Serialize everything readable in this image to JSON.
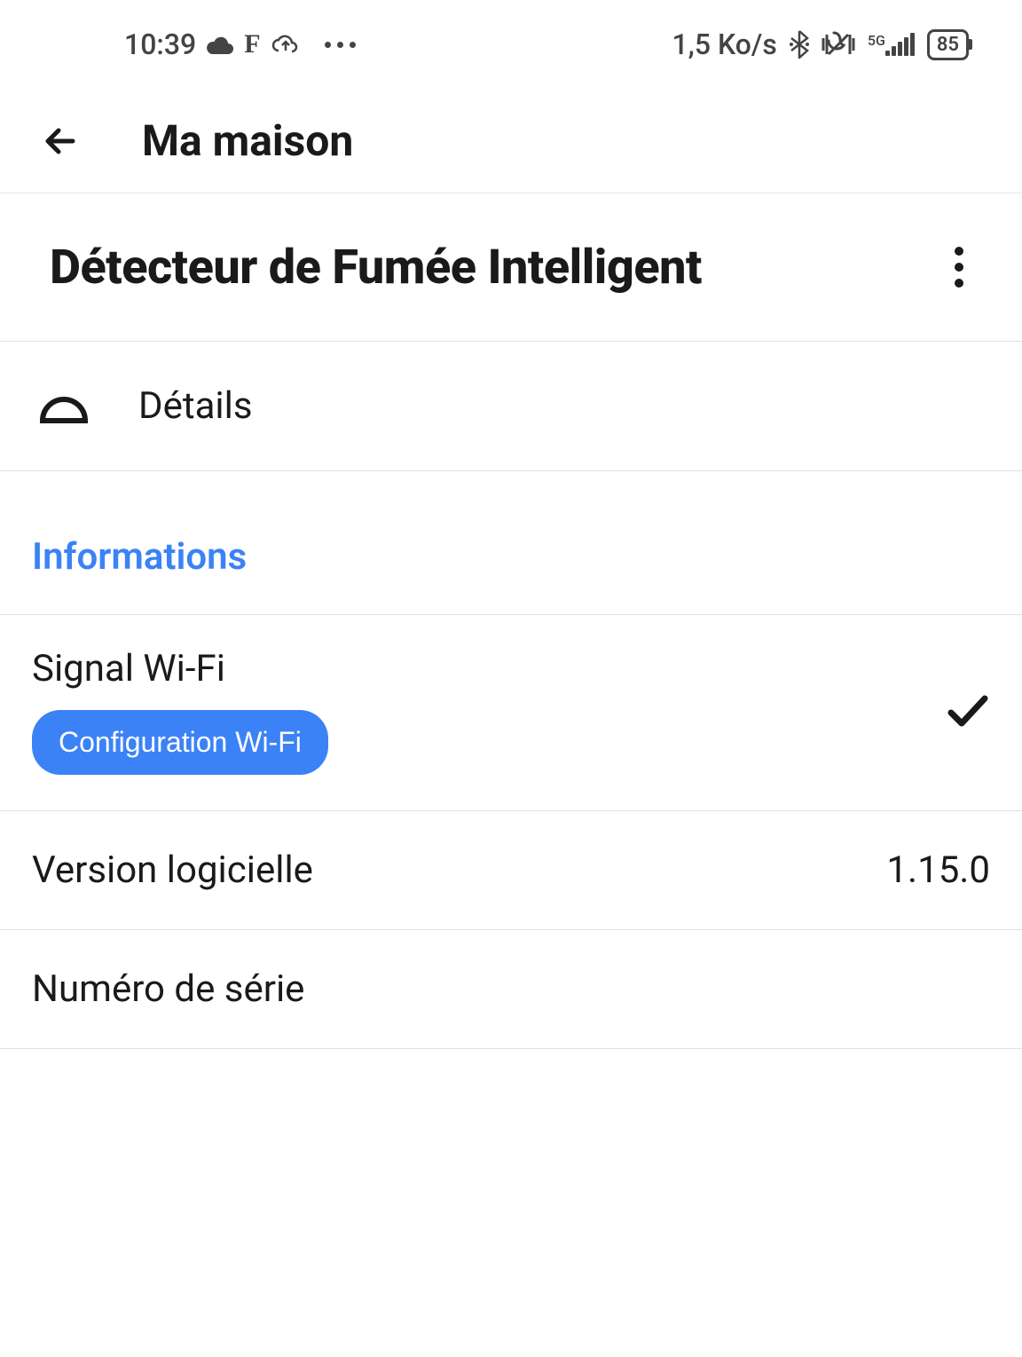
{
  "statusBar": {
    "time": "10:39",
    "dataRate": "1,5 Ko/s",
    "batteryLevel": "85",
    "network": "5G"
  },
  "nav": {
    "title": "Ma maison"
  },
  "device": {
    "title": "Détecteur de Fumée Intelligent"
  },
  "details": {
    "label": "Détails"
  },
  "section": {
    "title": "Informations"
  },
  "wifi": {
    "label": "Signal Wi-Fi",
    "configButton": "Configuration Wi-Fi"
  },
  "software": {
    "label": "Version logicielle",
    "value": "1.15.0"
  },
  "serial": {
    "label": "Numéro de série"
  }
}
